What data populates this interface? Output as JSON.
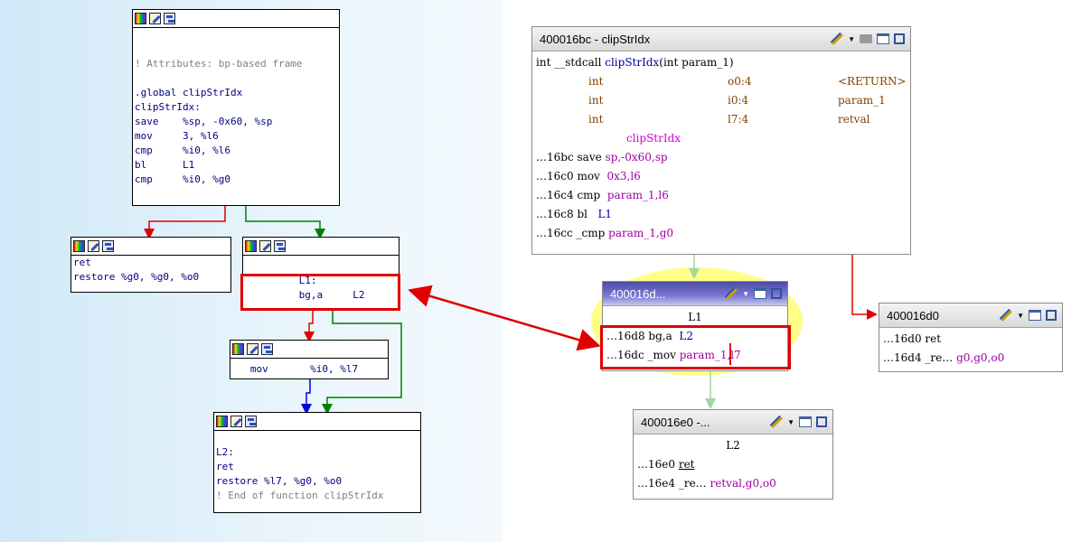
{
  "ida": {
    "node_main": {
      "lines": [
        "",
        "",
        "! Attributes: bp-based frame",
        "",
        ".global clipStrIdx",
        "clipStrIdx:",
        "save    %sp, -0x60, %sp",
        "mov     3, %l6",
        "cmp     %i0, %l6",
        "bl      L1",
        "cmp     %i0, %g0"
      ]
    },
    "node_ret": {
      "lines": [
        "ret",
        "restore %g0, %g0, %o0"
      ]
    },
    "node_l1": {
      "lines": [
        "         L1:",
        "         bg,a     L2"
      ]
    },
    "node_mov": {
      "lines": [
        "   mov       %i0, %l7"
      ]
    },
    "node_l2": {
      "lines": [
        "",
        "L2:",
        "ret",
        "restore %l7, %g0, %o0",
        "! End of function clipStrIdx"
      ]
    }
  },
  "ghidra": {
    "main": {
      "title": "400016bc - clipStrIdx",
      "signature": {
        "pre": "int __stdcall ",
        "name": "clipStrIdx",
        "args": "(int param_1)"
      },
      "vars": [
        {
          "type": "int",
          "loc": "o0:4",
          "name": "<RETURN>"
        },
        {
          "type": "int",
          "loc": "i0:4",
          "name": "param_1"
        },
        {
          "type": "int",
          "loc": "l7:4",
          "name": "retval"
        }
      ],
      "label": "clipStrIdx",
      "rows": [
        {
          "addr": "…16bc",
          "op": "save",
          "args": "sp,-0x60,sp"
        },
        {
          "addr": "…16c0",
          "op": "mov",
          "args": "0x3,l6"
        },
        {
          "addr": "…16c4",
          "op": "cmp",
          "args": "param_1,l6"
        },
        {
          "addr": "…16c8",
          "op": "bl",
          "args": "L1"
        },
        {
          "addr": "…16cc",
          "op": "_cmp",
          "args": "param_1,g0"
        }
      ]
    },
    "l1": {
      "title": "400016d...",
      "label": "L1",
      "rows": [
        {
          "addr": "…16d8",
          "op": "bg,a",
          "args": "L2"
        },
        {
          "addr": "…16dc",
          "op": "_mov",
          "args": "param_1,l7"
        }
      ]
    },
    "ret": {
      "title": "400016d0",
      "rows": [
        {
          "addr": "…16d0",
          "op": "ret",
          "args": ""
        },
        {
          "addr": "…16d4",
          "op": "_re…",
          "args": "g0,g0,o0"
        }
      ]
    },
    "l2": {
      "title": "400016e0 -...",
      "label": "L2",
      "rows": [
        {
          "addr": "…16e0",
          "op": "ret",
          "args": ""
        },
        {
          "addr": "…16e4",
          "op": "_re…",
          "args": "retval,g0,o0"
        }
      ]
    }
  },
  "colors": {
    "true_edge": "#e00000",
    "false_edge": "#008000",
    "fall_edge": "#0000e0",
    "ghidra_edge": "#a0d8a0",
    "highlight": "#e00000"
  },
  "icons": [
    "color-palette-icon",
    "edit-pencil-icon",
    "graph-icon",
    "dropdown-arrow-icon",
    "snapshot-icon",
    "window-icon",
    "maximize-icon"
  ]
}
